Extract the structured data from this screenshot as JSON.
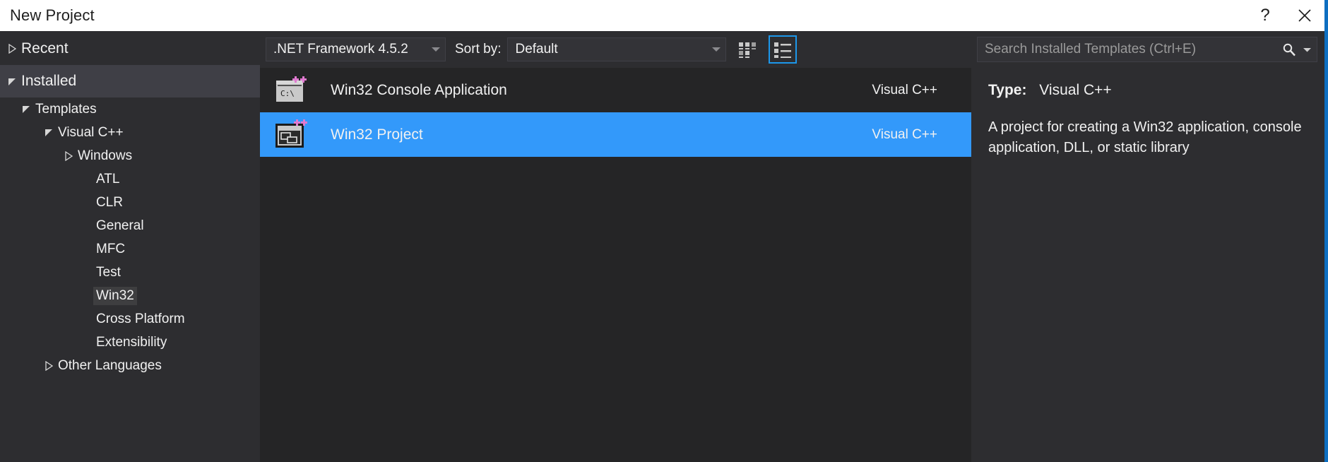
{
  "window": {
    "title": "New Project",
    "help_label": "?",
    "close_label": "×",
    "accent_color": "#0e6fc1"
  },
  "sidebar": {
    "items": [
      {
        "label": "Recent",
        "indent": 0,
        "twisty": "collapsed",
        "state": "normal"
      },
      {
        "label": "Installed",
        "indent": 0,
        "twisty": "expanded",
        "state": "highlight"
      },
      {
        "label": "Templates",
        "indent": 1,
        "twisty": "expanded",
        "state": "normal"
      },
      {
        "label": "Visual C++",
        "indent": 2,
        "twisty": "expanded",
        "state": "normal"
      },
      {
        "label": "Windows",
        "indent": 3,
        "twisty": "collapsed",
        "state": "normal"
      },
      {
        "label": "ATL",
        "indent": 4,
        "twisty": "none",
        "state": "normal"
      },
      {
        "label": "CLR",
        "indent": 4,
        "twisty": "none",
        "state": "normal"
      },
      {
        "label": "General",
        "indent": 4,
        "twisty": "none",
        "state": "normal"
      },
      {
        "label": "MFC",
        "indent": 4,
        "twisty": "none",
        "state": "normal"
      },
      {
        "label": "Test",
        "indent": 4,
        "twisty": "none",
        "state": "normal"
      },
      {
        "label": "Win32",
        "indent": 4,
        "twisty": "none",
        "state": "boxed"
      },
      {
        "label": "Cross Platform",
        "indent": 4,
        "twisty": "none",
        "state": "normal"
      },
      {
        "label": "Extensibility",
        "indent": 4,
        "twisty": "none",
        "state": "normal"
      },
      {
        "label": "Other Languages",
        "indent": 2,
        "twisty": "collapsed",
        "state": "normal"
      }
    ]
  },
  "toolbar": {
    "framework": {
      "value": ".NET Framework 4.5.2"
    },
    "sort_label": "Sort by:",
    "sort": {
      "value": "Default"
    },
    "views": [
      {
        "name": "tile-view",
        "selected": false
      },
      {
        "name": "list-view",
        "selected": true
      }
    ]
  },
  "templates": {
    "rows": [
      {
        "name": "Win32 Console Application",
        "language": "Visual C++",
        "icon": "console-cpp-icon",
        "selected": false
      },
      {
        "name": "Win32 Project",
        "language": "Visual C++",
        "icon": "window-cpp-icon",
        "selected": true
      }
    ]
  },
  "search": {
    "placeholder": "Search Installed Templates (Ctrl+E)",
    "value": ""
  },
  "detail": {
    "type_label": "Type:",
    "type_value": "Visual C++",
    "description": "A project for creating a Win32 application, console application, DLL, or static library"
  },
  "colors": {
    "selection_blue": "#3399fa",
    "view_selected_border": "#1c97ea",
    "panel_bg": "#2d2d30",
    "list_bg": "#252526"
  }
}
